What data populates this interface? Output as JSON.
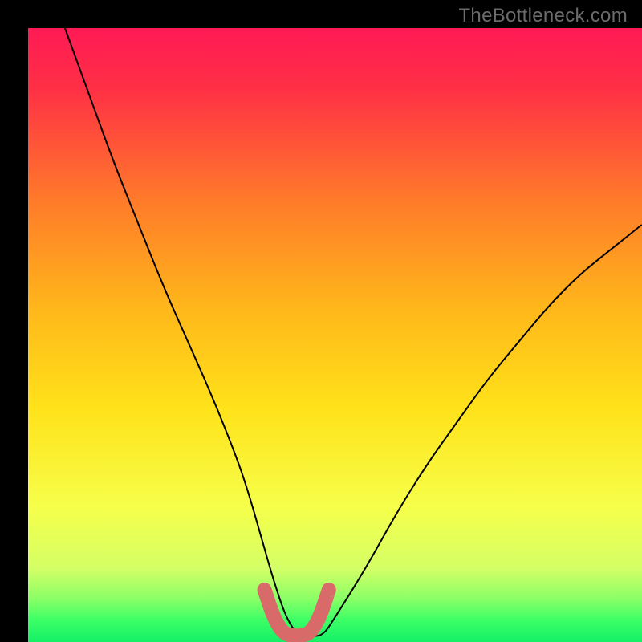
{
  "watermark": {
    "text": "TheBottleneck.com"
  },
  "chart_data": {
    "type": "line",
    "title": "",
    "xlabel": "",
    "ylabel": "",
    "xlim": [
      0,
      100
    ],
    "ylim": [
      0,
      100
    ],
    "series": [
      {
        "name": "bottleneck-curve",
        "x": [
          6,
          10,
          14,
          18,
          22,
          26,
          30,
          34,
          36,
          38,
          40,
          42,
          44,
          46,
          48,
          50,
          55,
          60,
          65,
          70,
          75,
          80,
          85,
          90,
          95,
          100
        ],
        "values": [
          100,
          89,
          78,
          68,
          58,
          49,
          40,
          30,
          24,
          17,
          10,
          4,
          1,
          1,
          1,
          4,
          12,
          21,
          29,
          36,
          43,
          49,
          55,
          60,
          64,
          68
        ]
      },
      {
        "name": "optimal-range-marker",
        "x": [
          38.5,
          40.0,
          41.5,
          43.0,
          44.5,
          46.0,
          47.5,
          49.0
        ],
        "values": [
          8.5,
          4.0,
          1.5,
          1.0,
          1.0,
          1.5,
          4.0,
          8.5
        ]
      }
    ],
    "background_gradient": {
      "top": "#ff1a4a",
      "upper_mid": "#ff7a2a",
      "mid": "#ffd61a",
      "lower_mid": "#f2ff66",
      "bottom": "#1aff66"
    }
  }
}
